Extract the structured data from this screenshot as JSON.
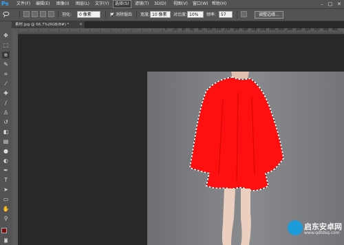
{
  "app": {
    "logo": "Ps"
  },
  "menu": [
    "文件(F)",
    "编辑(E)",
    "图像(I)",
    "图层(L)",
    "文字(Y)",
    "选择(S)",
    "滤镜(T)",
    "3D(D)",
    "视图(V)",
    "窗口(W)",
    "帮助(H)"
  ],
  "window_controls": [
    "–",
    "□",
    "✕"
  ],
  "options": {
    "feather_label": "羽化:",
    "feather_value": "0 像素",
    "antialias_label": "消除锯齿",
    "width_label": "宽度:",
    "width_value": "10 像素",
    "contrast_label": "对比度:",
    "contrast_value": "10%",
    "frequency_label": "频率:",
    "frequency_value": "57",
    "refine_edge": "调整边缘..."
  },
  "document": {
    "tab_title": "素材.jpg @ 66.7%(RGB/8#) *",
    "close": "×"
  },
  "ruler_ticks": [
    "0",
    "20",
    "40",
    "60",
    "80",
    "100",
    "120",
    "140",
    "160",
    "180",
    "200",
    "220",
    "240",
    "260",
    "280",
    "300",
    "320",
    "340",
    "360",
    "380"
  ],
  "tools": [
    "move-tool",
    "marquee-tool",
    "lasso-tool",
    "quick-select-tool",
    "crop-tool",
    "eyedropper-tool",
    "healing-tool",
    "brush-tool",
    "clone-stamp-tool",
    "history-brush-tool",
    "eraser-tool",
    "gradient-tool",
    "blur-tool",
    "dodge-tool",
    "pen-tool",
    "type-tool",
    "path-select-tool",
    "shape-tool",
    "hand-tool",
    "zoom-tool"
  ],
  "colors": {
    "foreground": "#7a0c0c",
    "background": "#ffffff",
    "dress": "#ff1010"
  },
  "watermark": {
    "title": "启东安卓网",
    "url": "www.qdtdsq.com"
  }
}
